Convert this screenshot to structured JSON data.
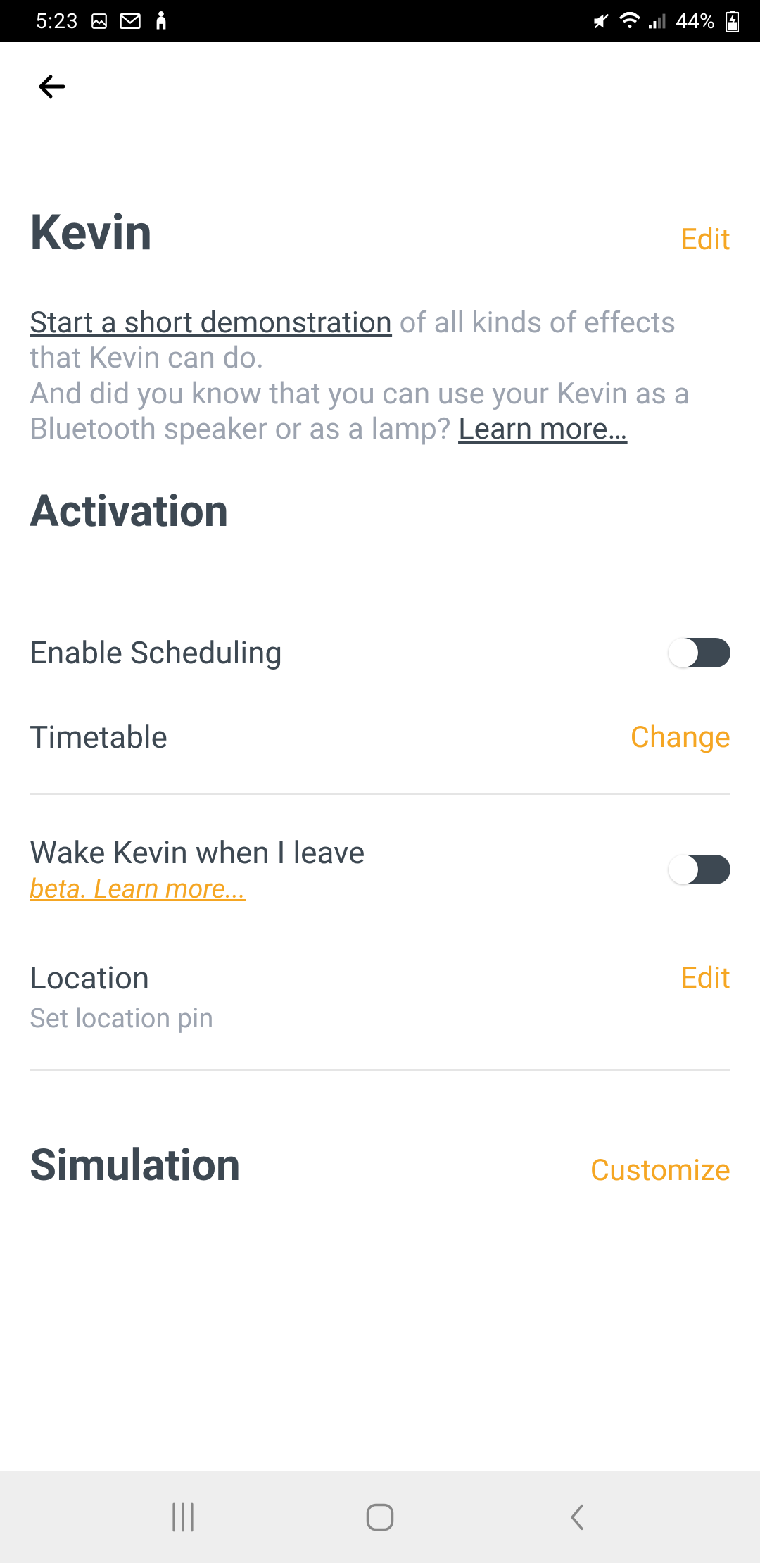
{
  "statusBar": {
    "time": "5:23",
    "battery": "44%"
  },
  "header": {
    "title": "Kevin",
    "editLabel": "Edit"
  },
  "description": {
    "demoLink": "Start a short demonstration",
    "para1b": " of all kinds of effects that Kevin can do.",
    "para2a": "And did you know that you can use your Kevin as a Bluetooth speaker or as a lamp? ",
    "learnMore": "Learn more…"
  },
  "sections": {
    "activation": {
      "heading": "Activation",
      "enableScheduling": "Enable Scheduling",
      "timetable": "Timetable",
      "changeLabel": "Change",
      "wakeLabel": "Wake Kevin when I leave",
      "betaLink": "beta. Learn more...",
      "locationLabel": "Location",
      "locationEdit": "Edit",
      "locationSub": "Set location pin"
    },
    "simulation": {
      "heading": "Simulation",
      "customize": "Customize"
    }
  }
}
